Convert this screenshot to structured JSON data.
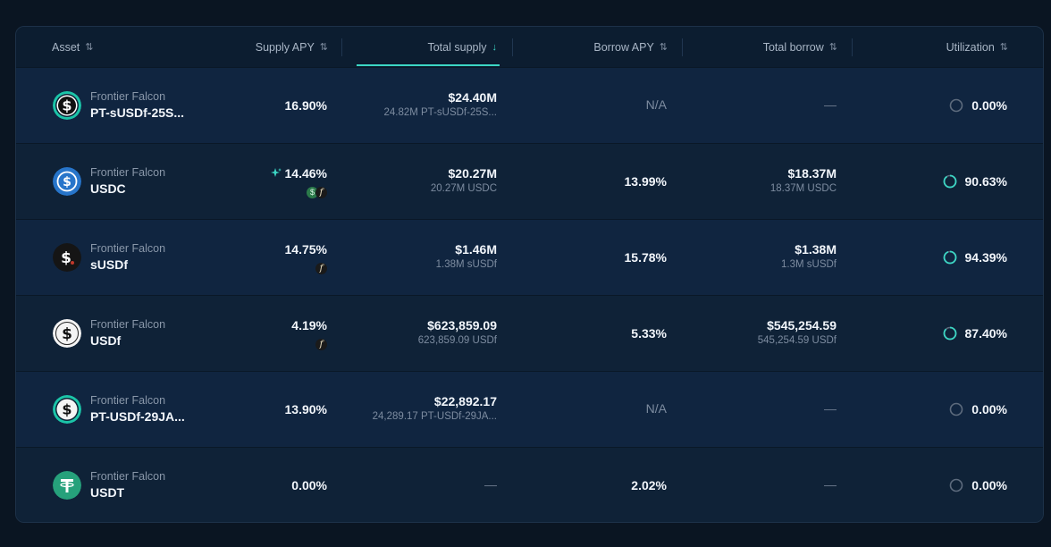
{
  "columns": [
    {
      "label": "Asset",
      "sort": "⇅"
    },
    {
      "label": "Supply APY",
      "sort": "⇅"
    },
    {
      "label": "Total supply",
      "sort": "↓"
    },
    {
      "label": "Borrow APY",
      "sort": "⇅"
    },
    {
      "label": "Total borrow",
      "sort": "⇅"
    },
    {
      "label": "Utilization",
      "sort": "⇅"
    }
  ],
  "rows": [
    {
      "issuer": "Frontier Falcon",
      "symbol": "PT-sUSDf-25S...",
      "supply_apy": "16.90%",
      "total_supply": "$24.40M",
      "total_supply_sub": "24.82M PT-sUSDf-25S...",
      "borrow_apy": "N/A",
      "total_borrow": "—",
      "total_borrow_sub": "",
      "utilization": "0.00%",
      "utilization_fraction": 0.0
    },
    {
      "issuer": "Frontier Falcon",
      "symbol": "USDC",
      "supply_apy": "14.46%",
      "total_supply": "$20.27M",
      "total_supply_sub": "20.27M USDC",
      "borrow_apy": "13.99%",
      "total_borrow": "$18.37M",
      "total_borrow_sub": "18.37M USDC",
      "utilization": "90.63%",
      "utilization_fraction": 0.9063
    },
    {
      "issuer": "Frontier Falcon",
      "symbol": "sUSDf",
      "supply_apy": "14.75%",
      "total_supply": "$1.46M",
      "total_supply_sub": "1.38M sUSDf",
      "borrow_apy": "15.78%",
      "total_borrow": "$1.38M",
      "total_borrow_sub": "1.3M sUSDf",
      "utilization": "94.39%",
      "utilization_fraction": 0.9439
    },
    {
      "issuer": "Frontier Falcon",
      "symbol": "USDf",
      "supply_apy": "4.19%",
      "total_supply": "$623,859.09",
      "total_supply_sub": "623,859.09 USDf",
      "borrow_apy": "5.33%",
      "total_borrow": "$545,254.59",
      "total_borrow_sub": "545,254.59 USDf",
      "utilization": "87.40%",
      "utilization_fraction": 0.874
    },
    {
      "issuer": "Frontier Falcon",
      "symbol": "PT-USDf-29JA...",
      "supply_apy": "13.90%",
      "total_supply": "$22,892.17",
      "total_supply_sub": "24,289.17 PT-USDf-29JA...",
      "borrow_apy": "N/A",
      "total_borrow": "—",
      "total_borrow_sub": "",
      "utilization": "0.00%",
      "utilization_fraction": 0.0
    },
    {
      "issuer": "Frontier Falcon",
      "symbol": "USDT",
      "supply_apy": "0.00%",
      "total_supply": "—",
      "total_supply_sub": "",
      "borrow_apy": "2.02%",
      "total_borrow": "—",
      "total_borrow_sub": "",
      "utilization": "0.00%",
      "utilization_fraction": 0.0
    }
  ],
  "icons": {
    "reward_sparkle": "sparkle-icon",
    "falcon_reward": "f",
    "green_reward": "$"
  },
  "colors": {
    "accent": "#3cd6c4",
    "background": "#0f2236"
  }
}
